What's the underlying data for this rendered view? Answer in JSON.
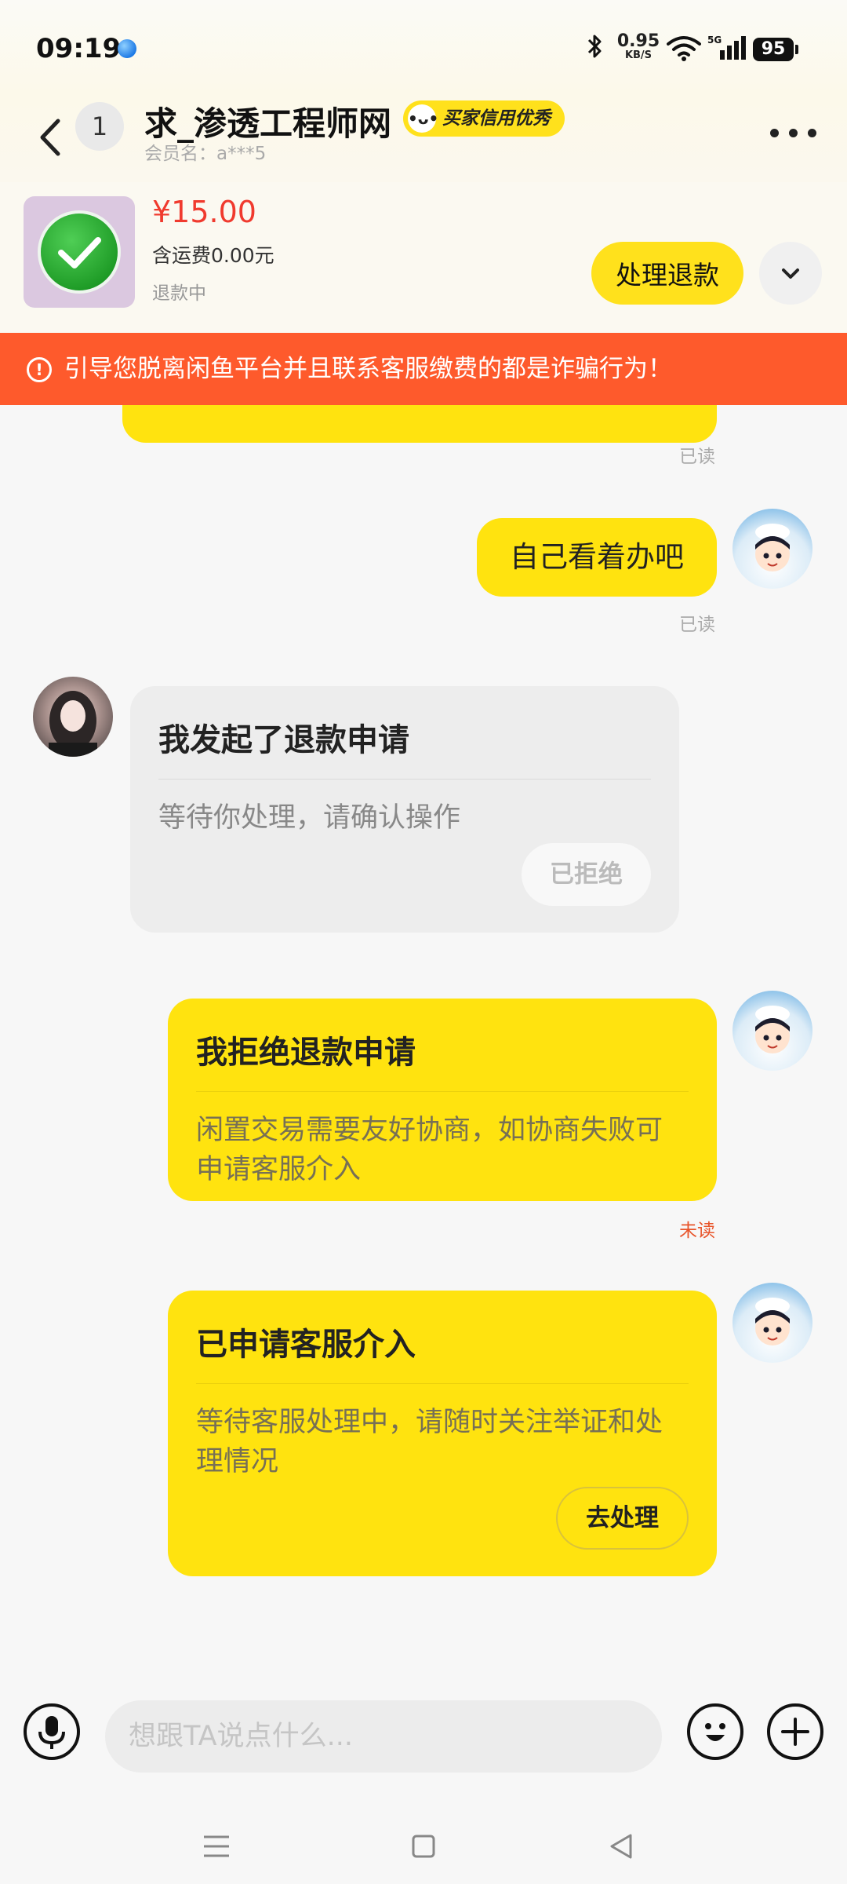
{
  "status_bar": {
    "time": "09:19",
    "net_speed_value": "0.95",
    "net_speed_unit": "KB/S",
    "network": "5G",
    "battery": "95"
  },
  "header": {
    "unread_count": "1",
    "seller_name": "求_渗透工程师网",
    "credit_badge": "买家信用优秀",
    "member_label": "会员名：a***5"
  },
  "product": {
    "price": "¥15.00",
    "shipping": "含运费0.00元",
    "status": "退款中",
    "handle_refund_label": "处理退款"
  },
  "warning": {
    "text": "引导您脱离闲鱼平台并且联系客服缴费的都是诈骗行为！"
  },
  "chat": {
    "read_label": "已读",
    "unread_label": "未读",
    "messages": [
      {
        "type": "text",
        "from": "me",
        "text": "自己看着办吧",
        "status": "已读"
      },
      {
        "type": "card",
        "from": "other",
        "title": "我发起了退款申请",
        "desc": "等待你处理，请确认操作",
        "button": "已拒绝"
      },
      {
        "type": "card",
        "from": "me",
        "title": "我拒绝退款申请",
        "desc": "闲置交易需要友好协商，如协商失败可申请客服介入",
        "status": "未读"
      },
      {
        "type": "card",
        "from": "me",
        "title": "已申请客服介入",
        "desc": "等待客服处理中，请随时关注举证和处理情况",
        "button": "去处理"
      }
    ]
  },
  "input": {
    "placeholder": "想跟TA说点什么..."
  },
  "colors": {
    "accent_yellow": "#ffe30f",
    "warning_orange": "#fe5a2c",
    "price_red": "#f03a2e"
  }
}
